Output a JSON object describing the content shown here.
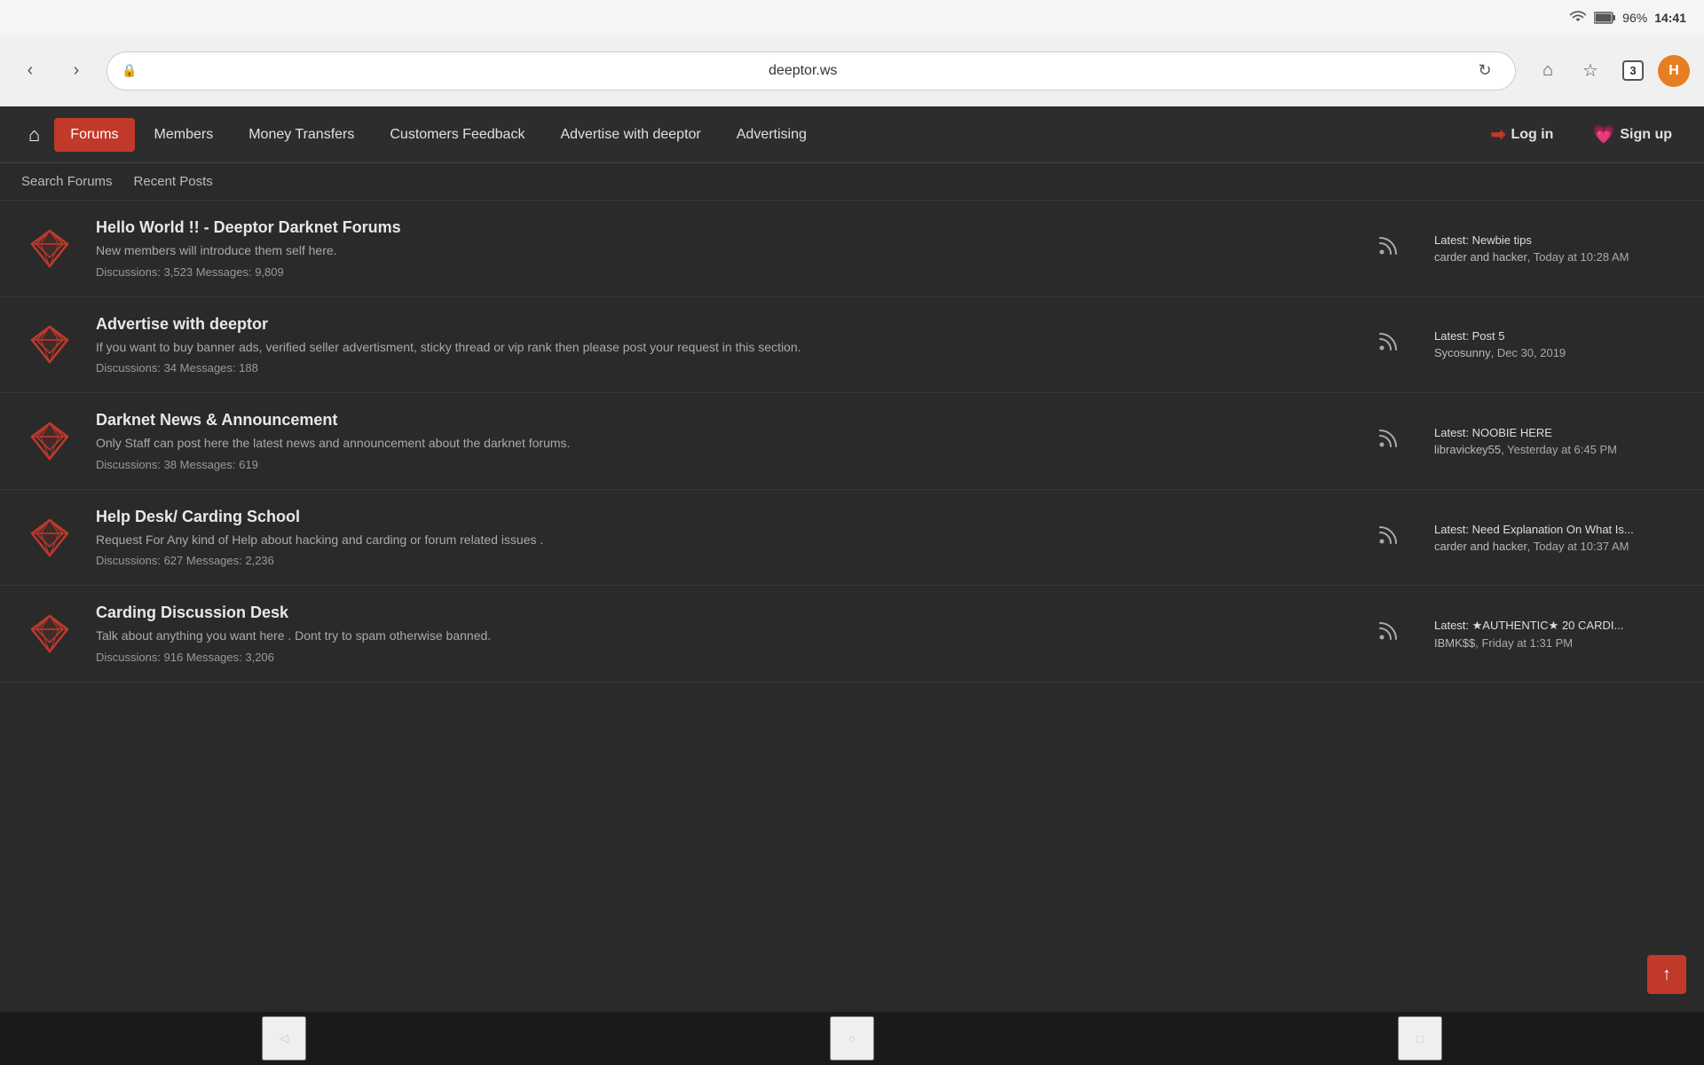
{
  "statusBar": {
    "battery": "96%",
    "time": "14:41"
  },
  "browser": {
    "backLabel": "‹",
    "forwardLabel": "›",
    "url": "deeptor.ws",
    "reloadLabel": "↻",
    "homeLabel": "⌂",
    "bookmarksLabel": "☆",
    "tabCount": "3",
    "menuLabel": "H"
  },
  "nav": {
    "homeLabel": "⌂",
    "items": [
      {
        "label": "Forums",
        "active": true
      },
      {
        "label": "Members",
        "active": false
      },
      {
        "label": "Money Transfers",
        "active": false
      },
      {
        "label": "Customers Feedback",
        "active": false
      },
      {
        "label": "Advertise with deeptor",
        "active": false
      },
      {
        "label": "Advertising",
        "active": false
      }
    ],
    "loginLabel": "Log in",
    "signupLabel": "Sign up"
  },
  "subNav": {
    "items": [
      {
        "label": "Search Forums"
      },
      {
        "label": "Recent Posts"
      }
    ]
  },
  "forums": [
    {
      "title": "Hello World !! - Deeptor Darknet Forums",
      "description": "New members will introduce them self here.",
      "discussions": "3,523",
      "messages": "9,809",
      "latestTitle": "Latest: Newbie tips",
      "latestUser": "carder and hacker",
      "latestTime": "Today at 10:28 AM"
    },
    {
      "title": "Advertise with deeptor",
      "description": "If you want to buy banner ads, verified seller advertisment, sticky thread or vip rank then please post your request in this section.",
      "discussions": "34",
      "messages": "188",
      "latestTitle": "Latest: Post 5",
      "latestUser": "Sycosunny",
      "latestTime": "Dec 30, 2019"
    },
    {
      "title": "Darknet News & Announcement",
      "description": "Only Staff can post here the latest news and announcement about the darknet forums.",
      "discussions": "38",
      "messages": "619",
      "latestTitle": "Latest: NOOBIE HERE",
      "latestUser": "libravickey55",
      "latestTime": "Yesterday at 6:45 PM"
    },
    {
      "title": "Help Desk/ Carding School",
      "description": "Request For Any kind of Help about hacking and carding or forum related issues .",
      "discussions": "627",
      "messages": "2,236",
      "latestTitle": "Latest: Need Explanation On What Is...",
      "latestUser": "carder and hacker",
      "latestTime": "Today at 10:37 AM"
    },
    {
      "title": "Carding Discussion Desk",
      "description": "Talk about anything you want here . Dont try to spam otherwise banned.",
      "discussions": "916",
      "messages": "3,206",
      "latestTitle": "Latest: ★AUTHENTIC★ 20 CARDI...",
      "latestUser": "IBMK$$",
      "latestTime": "Friday at 1:31 PM"
    }
  ],
  "scrollTopLabel": "↑",
  "androidNav": {
    "backLabel": "◁",
    "homeLabel": "○",
    "recentLabel": "□"
  }
}
